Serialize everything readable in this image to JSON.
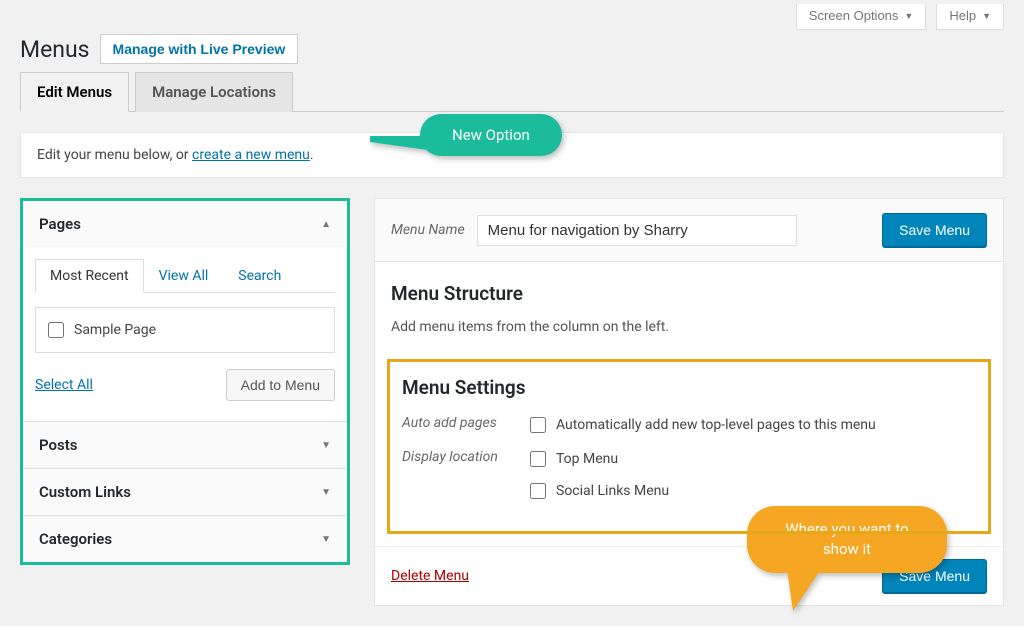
{
  "top_controls": {
    "screen_options": "Screen Options",
    "help": "Help"
  },
  "header": {
    "title": "Menus",
    "live_preview": "Manage with Live Preview"
  },
  "tabs": {
    "edit": "Edit Menus",
    "locations": "Manage Locations"
  },
  "callouts": {
    "new_option": "New Option",
    "where_show": "Where you want to show it"
  },
  "notice": {
    "prefix": "Edit your menu below, or ",
    "link": "create a new menu",
    "suffix": "."
  },
  "sidebar": {
    "pages": {
      "title": "Pages",
      "tabs": {
        "recent": "Most Recent",
        "view_all": "View All",
        "search": "Search"
      },
      "items": [
        {
          "label": "Sample Page"
        }
      ],
      "select_all": "Select All",
      "add_to_menu": "Add to Menu"
    },
    "posts": "Posts",
    "custom_links": "Custom Links",
    "categories": "Categories"
  },
  "menu_panel": {
    "name_label": "Menu Name",
    "name_value": "Menu for navigation by Sharry",
    "save": "Save Menu",
    "structure_title": "Menu Structure",
    "structure_desc": "Add menu items from the column on the left.",
    "settings_title": "Menu Settings",
    "auto_add_label": "Auto add pages",
    "auto_add_desc": "Automatically add new top-level pages to this menu",
    "display_loc_label": "Display location",
    "loc_top": "Top Menu",
    "loc_social": "Social Links Menu",
    "delete": "Delete Menu"
  }
}
